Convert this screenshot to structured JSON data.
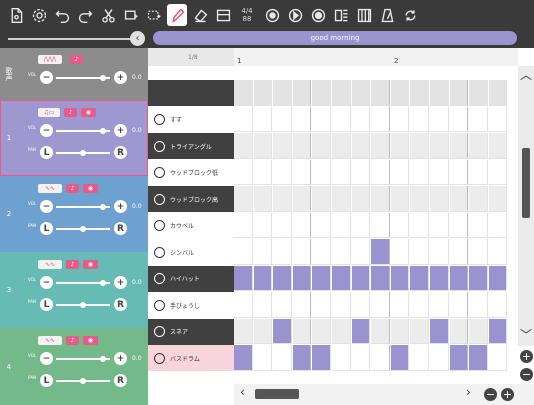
{
  "toolbar": {
    "time_signature_top": "4/4",
    "time_signature_bottom": "88",
    "icons": [
      "file-icon",
      "settings-icon",
      "undo-icon",
      "redo-icon",
      "cut-icon",
      "copy-icon",
      "paste-icon",
      "pen-icon",
      "eraser-icon",
      "keyboard-select-icon",
      "time-signature",
      "record-icon",
      "play-icon",
      "stop-icon",
      "score-icon",
      "piano-icon",
      "metronome-icon",
      "loop-icon"
    ]
  },
  "song": {
    "title": "good morning"
  },
  "ruler": {
    "division": "1/8",
    "measures": [
      "1",
      "2"
    ]
  },
  "tracks": [
    {
      "number": "",
      "side_label": "歌声",
      "color": "#8c8c8c",
      "vol": "0.0",
      "has_pan": false
    },
    {
      "number": "1",
      "color": "#9f97cf",
      "vol": "0.0",
      "pan_l": "L",
      "pan_r": "R",
      "has_pan": true,
      "selected": true
    },
    {
      "number": "2",
      "color": "#6ea1cf",
      "vol": "0.0",
      "pan_l": "L",
      "pan_r": "R",
      "has_pan": true
    },
    {
      "number": "3",
      "color": "#67bbb5",
      "vol": "0.0",
      "pan_l": "L",
      "pan_r": "R",
      "has_pan": true
    },
    {
      "number": "4",
      "color": "#74b98a",
      "vol": "0.0",
      "pan_l": "L",
      "pan_r": "R",
      "has_pan": true
    }
  ],
  "labels": {
    "vol": "VOL",
    "pan": "PAN",
    "plus": "+"
  },
  "instruments": [
    {
      "name": "",
      "style": "dark"
    },
    {
      "name": "すず",
      "style": "plain",
      "icon": "bell-icon"
    },
    {
      "name": "トライアングル",
      "style": "dark",
      "icon": "triangle-icon"
    },
    {
      "name": "ウッドブロック低",
      "style": "plain",
      "icon": "woodblock-icon"
    },
    {
      "name": "ウッドブロック高",
      "style": "dark",
      "icon": "woodblock-icon"
    },
    {
      "name": "カウベル",
      "style": "plain",
      "icon": "cowbell-icon"
    },
    {
      "name": "シンバル",
      "style": "plain",
      "icon": "cymbal-icon"
    },
    {
      "name": "ハイハット",
      "style": "dark",
      "icon": "hihat-icon"
    },
    {
      "name": "手びょうし",
      "style": "plain",
      "icon": "clap-icon"
    },
    {
      "name": "スネア",
      "style": "dark",
      "icon": "snare-icon"
    },
    {
      "name": "バスドラム",
      "style": "pink",
      "icon": "bassdrum-icon"
    }
  ],
  "pattern": {
    "rows": [
      [],
      [],
      [],
      [],
      [],
      [],
      [
        7
      ],
      [
        0,
        1,
        2,
        3,
        4,
        5,
        6,
        7,
        8,
        9,
        10,
        11,
        12,
        13
      ],
      [],
      [
        2,
        6,
        10,
        13
      ],
      [
        0,
        3,
        4,
        8,
        11,
        12
      ]
    ],
    "steps": 14
  },
  "colors": {
    "note": "#9b93cf",
    "pink_row": "#f8d4dc",
    "dark_row": "#ececec"
  }
}
